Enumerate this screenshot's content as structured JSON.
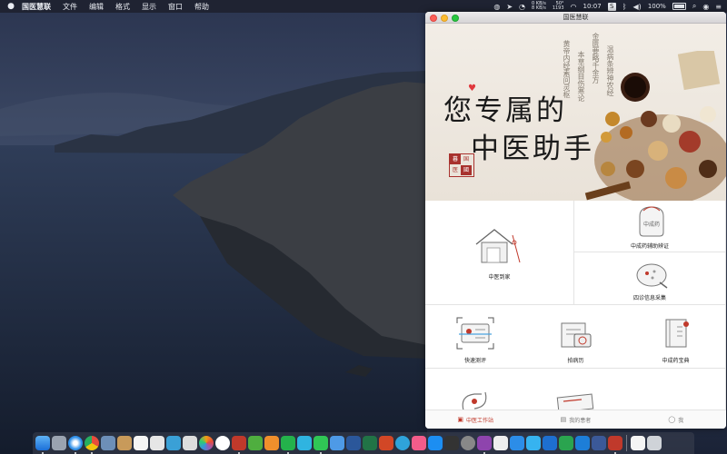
{
  "menubar": {
    "apple": "",
    "app_name": "国医慧联",
    "menus": [
      "文件",
      "编辑",
      "格式",
      "显示",
      "窗口",
      "帮助"
    ],
    "net_up": "0 KB/s",
    "net_down": "8 KB/s",
    "temp": "50°",
    "fan": "1193",
    "time": "10:07",
    "battery": "100%",
    "s_badge": "S"
  },
  "window": {
    "title": "国医慧联",
    "banner": {
      "line1": "您专属的",
      "line2": "中医助手",
      "seal": [
        "暮",
        "国",
        "医",
        "國"
      ]
    },
    "features_top": [
      {
        "label": "中医到家",
        "icon": "house-icon"
      },
      {
        "label": "中成药辅助辨证",
        "icon": "medicine-bag-icon"
      },
      {
        "label": "四诊信息采集",
        "icon": "diagnosis-bowl-icon"
      }
    ],
    "features_mid": [
      {
        "label": "快速测评",
        "icon": "id-scan-icon"
      },
      {
        "label": "拍病历",
        "icon": "camera-record-icon"
      },
      {
        "label": "中成药宝典",
        "icon": "book-icon"
      }
    ],
    "tabs": [
      {
        "label": "中医工作站",
        "icon": "workstation-icon",
        "active": true
      },
      {
        "label": "我的患者",
        "icon": "patients-icon",
        "active": false
      },
      {
        "label": "我",
        "icon": "user-icon",
        "active": false
      }
    ]
  },
  "dock": {
    "apps": [
      "finder",
      "launchpad",
      "safari",
      "chrome",
      "preview",
      "calendar",
      "notes",
      "photos",
      "tv",
      "music",
      "sublime",
      "pycharm",
      "messages",
      "wechat",
      "mail",
      "word",
      "excel",
      "powerpoint",
      "telegram",
      "itunes",
      "app-store",
      "activity-monitor",
      "system-preferences",
      "rp",
      "other1",
      "other2",
      "other3",
      "vscode",
      "maps",
      "other4",
      "other5",
      "guoyi",
      "documents",
      "trash"
    ]
  },
  "colors": {
    "accent": "#c0392b",
    "window_bg": "#ffffff",
    "banner_bg": "#efe9e0"
  }
}
